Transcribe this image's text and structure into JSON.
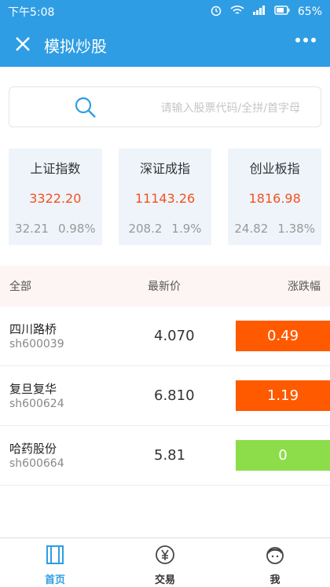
{
  "status": {
    "time": "下午5:08",
    "battery": "65%"
  },
  "header": {
    "title": "模拟炒股",
    "accent": "#2f9de4"
  },
  "search": {
    "placeholder": "请输入股票代码/全拼/首字母"
  },
  "indices": [
    {
      "name": "上证指数",
      "value": "3322.20",
      "change": "32.21",
      "percent": "0.98%"
    },
    {
      "name": "深证成指",
      "value": "11143.26",
      "change": "208.2",
      "percent": "1.9%"
    },
    {
      "name": "创业板指",
      "value": "1816.98",
      "change": "24.82",
      "percent": "1.38%"
    }
  ],
  "list": {
    "headers": {
      "all": "全部",
      "price": "最新价",
      "change": "涨跌幅"
    },
    "rows": [
      {
        "name": "四川路桥",
        "code": "sh600039",
        "price": "4.070",
        "change": "0.49",
        "color": "#ff5a00"
      },
      {
        "name": "复旦复华",
        "code": "sh600624",
        "price": "6.810",
        "change": "1.19",
        "color": "#ff5a00"
      },
      {
        "name": "哈药股份",
        "code": "sh600664",
        "price": "5.81",
        "change": "0",
        "color": "#8ddd4a"
      }
    ]
  },
  "tabs": [
    {
      "label": "首页",
      "icon": "book-icon"
    },
    {
      "label": "交易",
      "icon": "yen-coin-icon"
    },
    {
      "label": "我",
      "icon": "user-face-icon"
    }
  ]
}
